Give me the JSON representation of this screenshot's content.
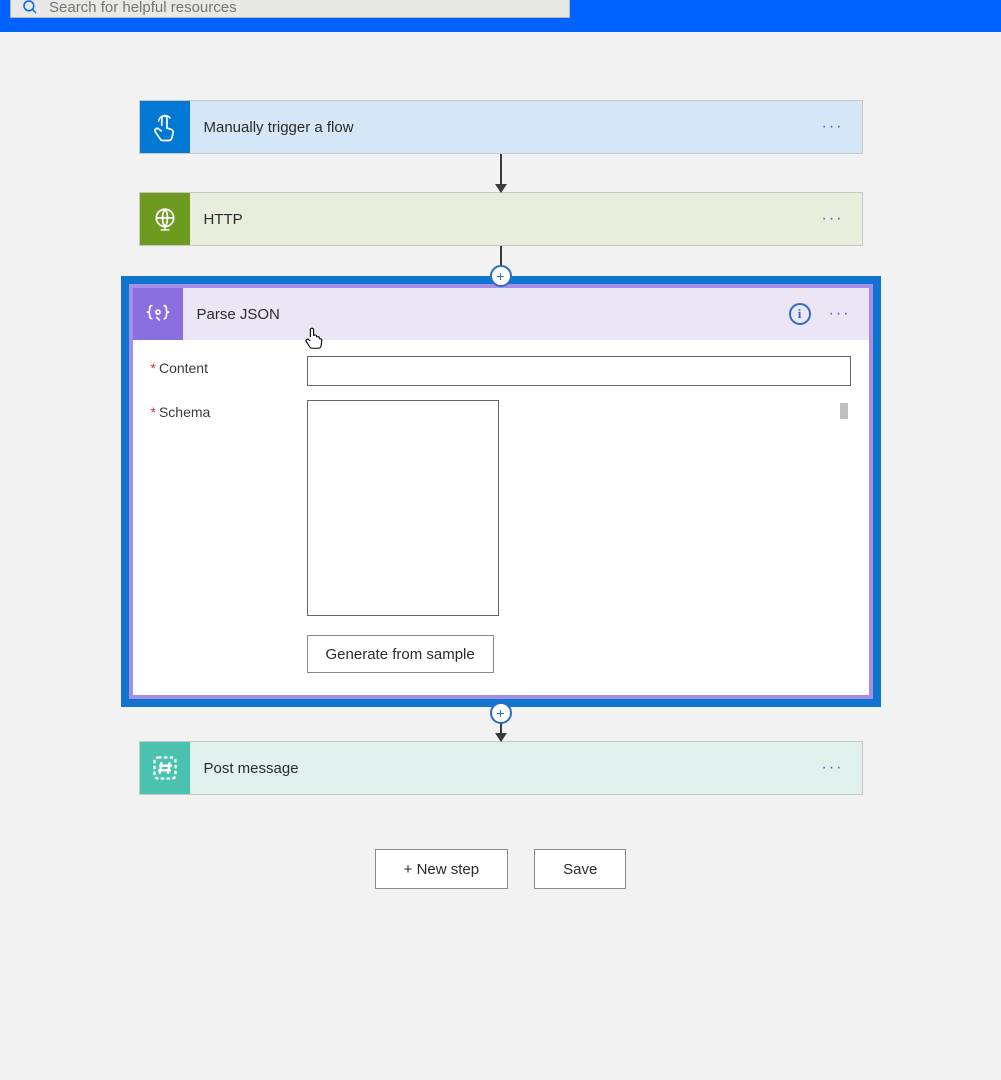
{
  "search": {
    "placeholder": "Search for helpful resources"
  },
  "steps": {
    "trigger": {
      "title": "Manually trigger a flow"
    },
    "http": {
      "title": "HTTP"
    },
    "parse": {
      "title": "Parse JSON",
      "fields": {
        "content": {
          "label": "Content",
          "value": ""
        },
        "schema": {
          "label": "Schema",
          "value": ""
        }
      },
      "generate_button": "Generate from sample"
    },
    "post": {
      "title": "Post message"
    }
  },
  "footer": {
    "new_step": "+ New step",
    "save": "Save"
  },
  "glyphs": {
    "info": "i",
    "plus": "+",
    "ellipsis": "···"
  }
}
